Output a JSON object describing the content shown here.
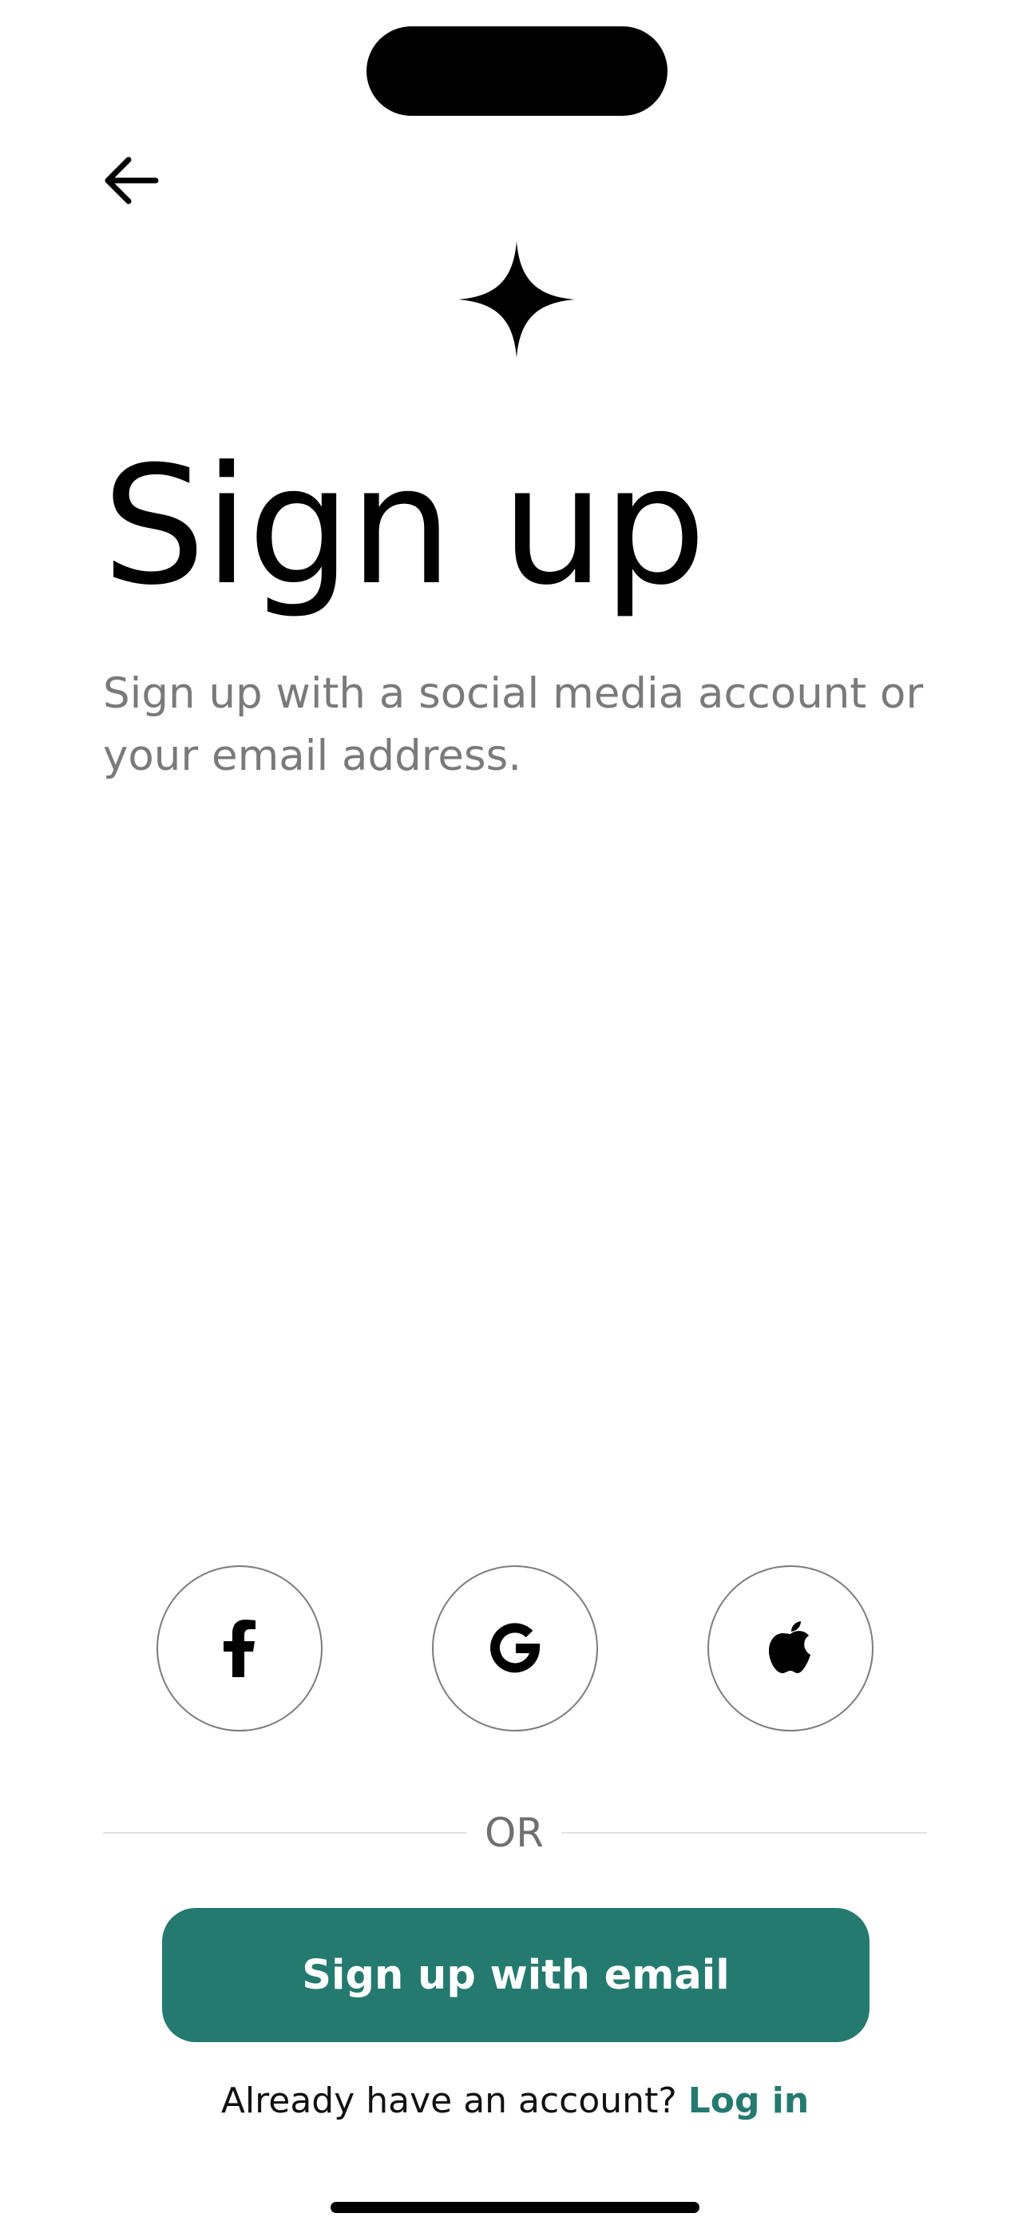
{
  "header": {
    "back_icon": "arrow-left-icon",
    "logo_icon": "four-point-star-icon"
  },
  "main": {
    "title": "Sign up",
    "subtitle": "Sign up with a social media account or your email address."
  },
  "social": {
    "buttons": [
      {
        "provider": "Facebook",
        "icon": "facebook-icon"
      },
      {
        "provider": "Google",
        "icon": "google-icon"
      },
      {
        "provider": "Apple",
        "icon": "apple-icon"
      }
    ]
  },
  "divider": {
    "label": "OR"
  },
  "actions": {
    "email_button_label": "Sign up with email",
    "login_prompt": "Already have an account?",
    "login_link": "Log in"
  },
  "colors": {
    "accent": "#257a6f",
    "subtitle_text": "#7a7a7a",
    "background": "#ffffff"
  }
}
